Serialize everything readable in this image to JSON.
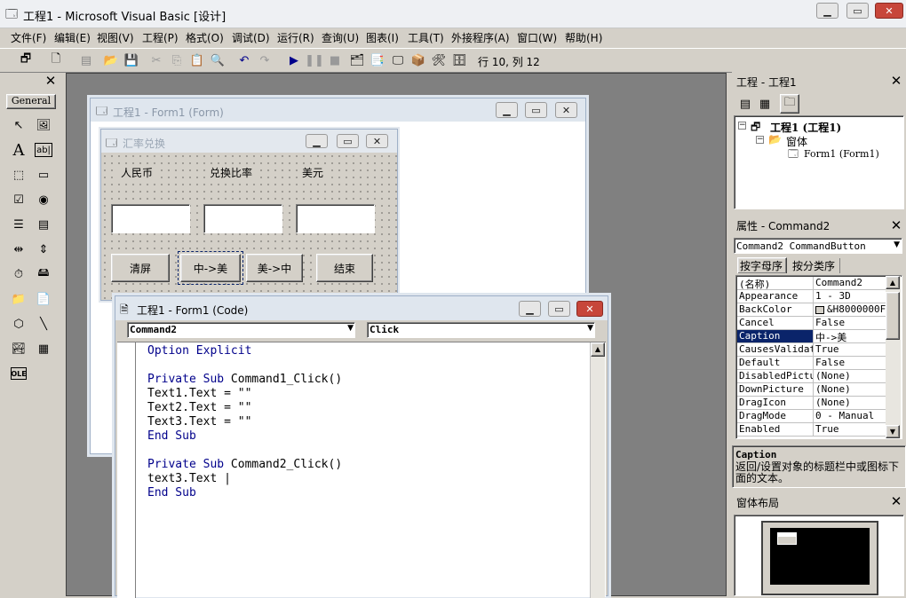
{
  "window": {
    "title": "工程1 - Microsoft Visual Basic [设计]"
  },
  "menu": [
    "文件(F)",
    "编辑(E)",
    "视图(V)",
    "工程(P)",
    "格式(O)",
    "调试(D)",
    "运行(R)",
    "查询(U)",
    "图表(I)",
    "工具(T)",
    "外接程序(A)",
    "窗口(W)",
    "帮助(H)"
  ],
  "toolbar": {
    "position": "行 10, 列 12"
  },
  "toolbox": {
    "title": "General"
  },
  "form_designer": {
    "title": "工程1 - Form1 (Form)",
    "form": {
      "caption": "汇率兑换",
      "labels": [
        "人民币",
        "兑换比率",
        "美元"
      ],
      "buttons": [
        "清屏",
        "中->美",
        "美->中",
        "结束"
      ]
    }
  },
  "code_window": {
    "title": "工程1 - Form1 (Code)",
    "object": "Command2",
    "procedure": "Click",
    "lines": [
      {
        "kw": "Option Explicit",
        "rest": ""
      },
      {
        "kw": "",
        "rest": ""
      },
      {
        "kw": "Private Sub ",
        "rest": "Command1_Click()"
      },
      {
        "kw": "",
        "rest": "Text1.Text = \"\""
      },
      {
        "kw": "",
        "rest": "Text2.Text = \"\""
      },
      {
        "kw": "",
        "rest": "Text3.Text = \"\""
      },
      {
        "kw": "End Sub",
        "rest": ""
      },
      {
        "kw": "",
        "rest": ""
      },
      {
        "kw": "Private Sub ",
        "rest": "Command2_Click()"
      },
      {
        "kw": "",
        "rest": "text3.Text |"
      },
      {
        "kw": "End Sub",
        "rest": ""
      }
    ]
  },
  "project": {
    "title": "工程 - 工程1",
    "root": "工程1 (工程1)",
    "folder": "窗体",
    "item": "Form1 (Form1)"
  },
  "properties": {
    "title": "属性 - Command2",
    "object_select": "Command2 CommandButton",
    "tab_alpha": "按字母序",
    "tab_category": "按分类序",
    "rows": [
      {
        "name": "(名称)",
        "value": "Command2"
      },
      {
        "name": "Appearance",
        "value": "1 - 3D"
      },
      {
        "name": "BackColor",
        "value": "&H8000000F"
      },
      {
        "name": "Cancel",
        "value": "False"
      },
      {
        "name": "Caption",
        "value": "中->美"
      },
      {
        "name": "CausesValidati",
        "value": "True"
      },
      {
        "name": "Default",
        "value": "False"
      },
      {
        "name": "DisabledPictur",
        "value": "(None)"
      },
      {
        "name": "DownPicture",
        "value": "(None)"
      },
      {
        "name": "DragIcon",
        "value": "(None)"
      },
      {
        "name": "DragMode",
        "value": "0 - Manual"
      },
      {
        "name": "Enabled",
        "value": "True"
      }
    ],
    "desc_title": "Caption",
    "desc_text": "返回/设置对象的标题栏中或图标下面的文本。"
  },
  "layout_pane": {
    "title": "窗体布局"
  },
  "colors": {
    "selection": "#0a246a",
    "keyword": "#00008b",
    "close": "#c7463a"
  }
}
